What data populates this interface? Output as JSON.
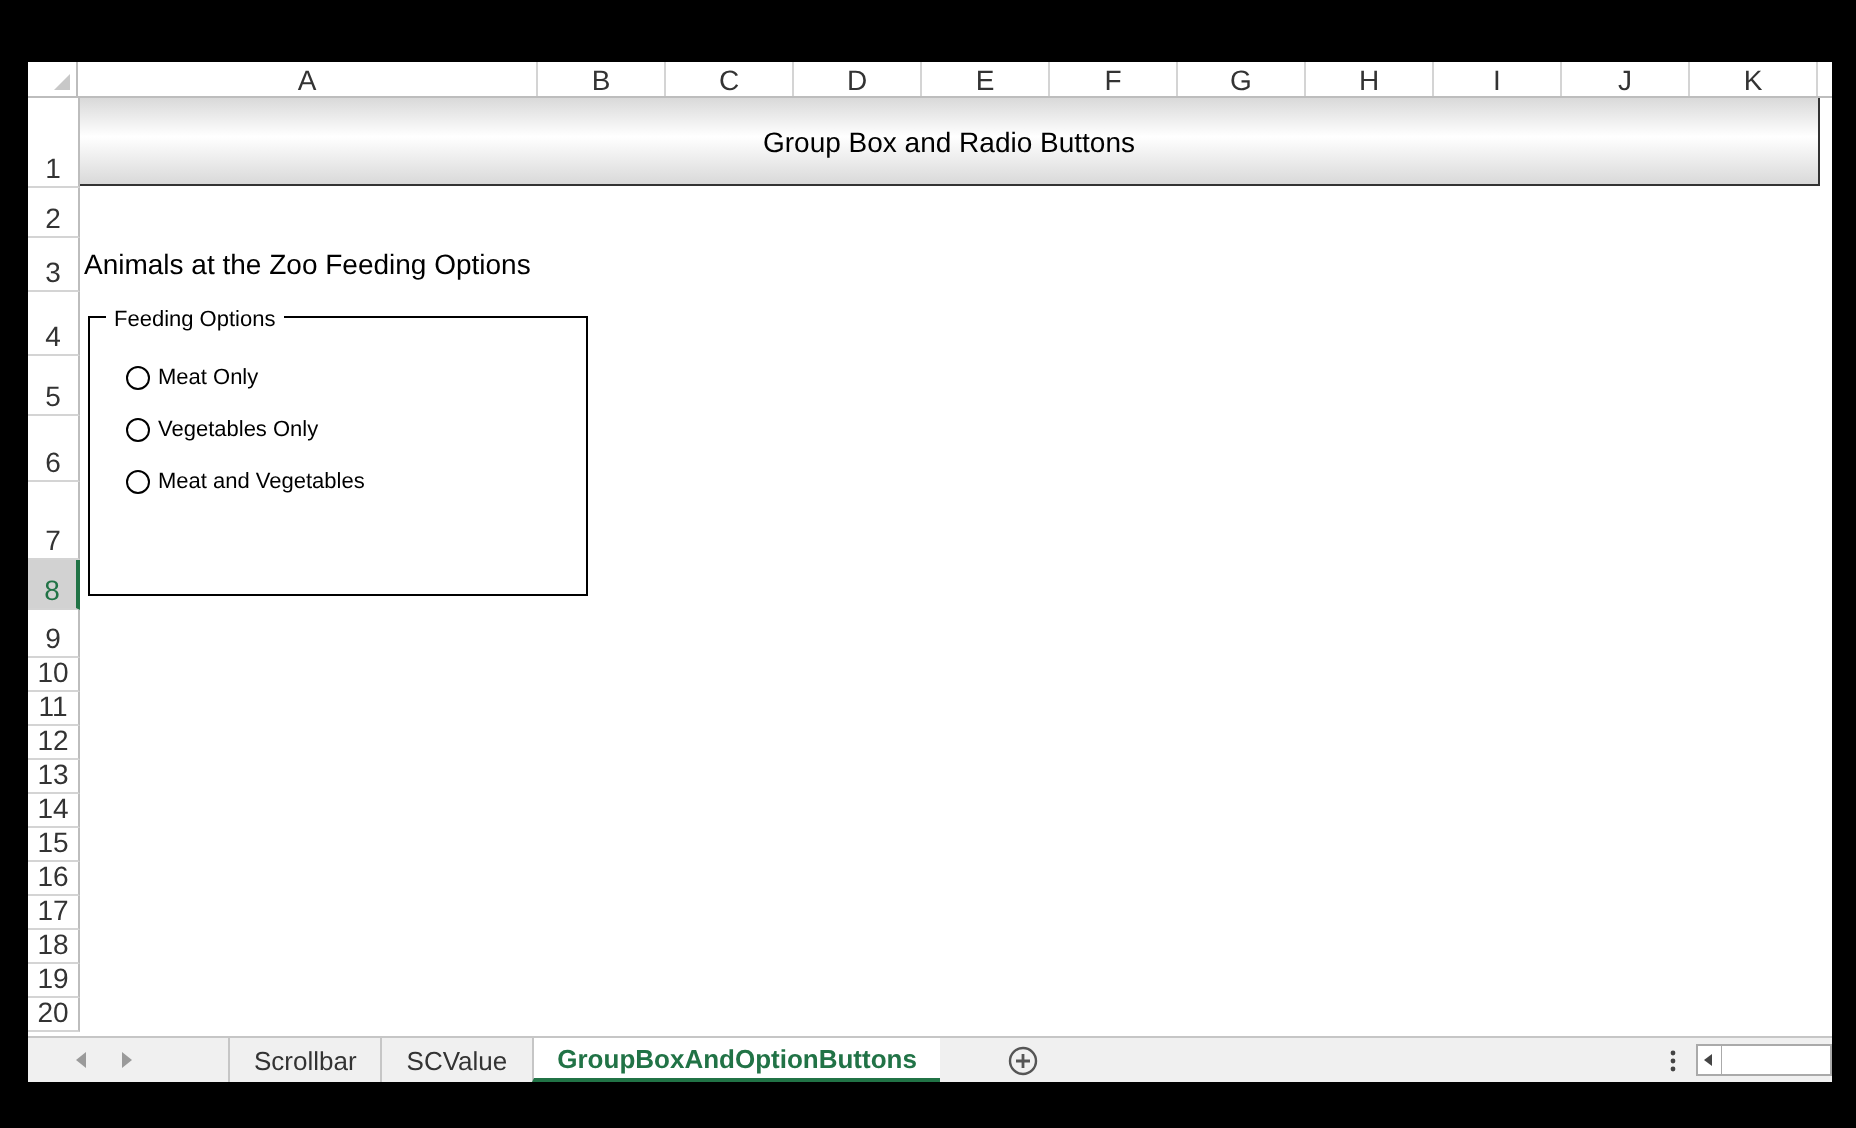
{
  "columns": [
    "A",
    "B",
    "C",
    "D",
    "E",
    "F",
    "G",
    "H",
    "I",
    "J",
    "K"
  ],
  "rows": [
    {
      "label": "1",
      "selected": false
    },
    {
      "label": "2",
      "selected": false
    },
    {
      "label": "3",
      "selected": false
    },
    {
      "label": "4",
      "selected": false
    },
    {
      "label": "5",
      "selected": false
    },
    {
      "label": "6",
      "selected": false
    },
    {
      "label": "7",
      "selected": false
    },
    {
      "label": "8",
      "selected": true
    },
    {
      "label": "9",
      "selected": false
    },
    {
      "label": "10",
      "selected": false
    },
    {
      "label": "11",
      "selected": false
    },
    {
      "label": "12",
      "selected": false
    },
    {
      "label": "13",
      "selected": false
    },
    {
      "label": "14",
      "selected": false
    },
    {
      "label": "15",
      "selected": false
    },
    {
      "label": "16",
      "selected": false
    },
    {
      "label": "17",
      "selected": false
    },
    {
      "label": "18",
      "selected": false
    },
    {
      "label": "19",
      "selected": false
    },
    {
      "label": "20",
      "selected": false
    }
  ],
  "title_banner": "Group Box and Radio Buttons",
  "cell_a3": "Animals at the Zoo Feeding Options",
  "group_box": {
    "title": "Feeding Options",
    "options": [
      {
        "label": "Meat Only",
        "selected": false
      },
      {
        "label": "Vegetables Only",
        "selected": false
      },
      {
        "label": "Meat and Vegetables",
        "selected": false
      }
    ]
  },
  "sheet_tabs": [
    {
      "label": "Scrollbar",
      "selected": false
    },
    {
      "label": "SCValue",
      "selected": false
    },
    {
      "label": "GroupBoxAndOptionButtons",
      "selected": true
    }
  ]
}
